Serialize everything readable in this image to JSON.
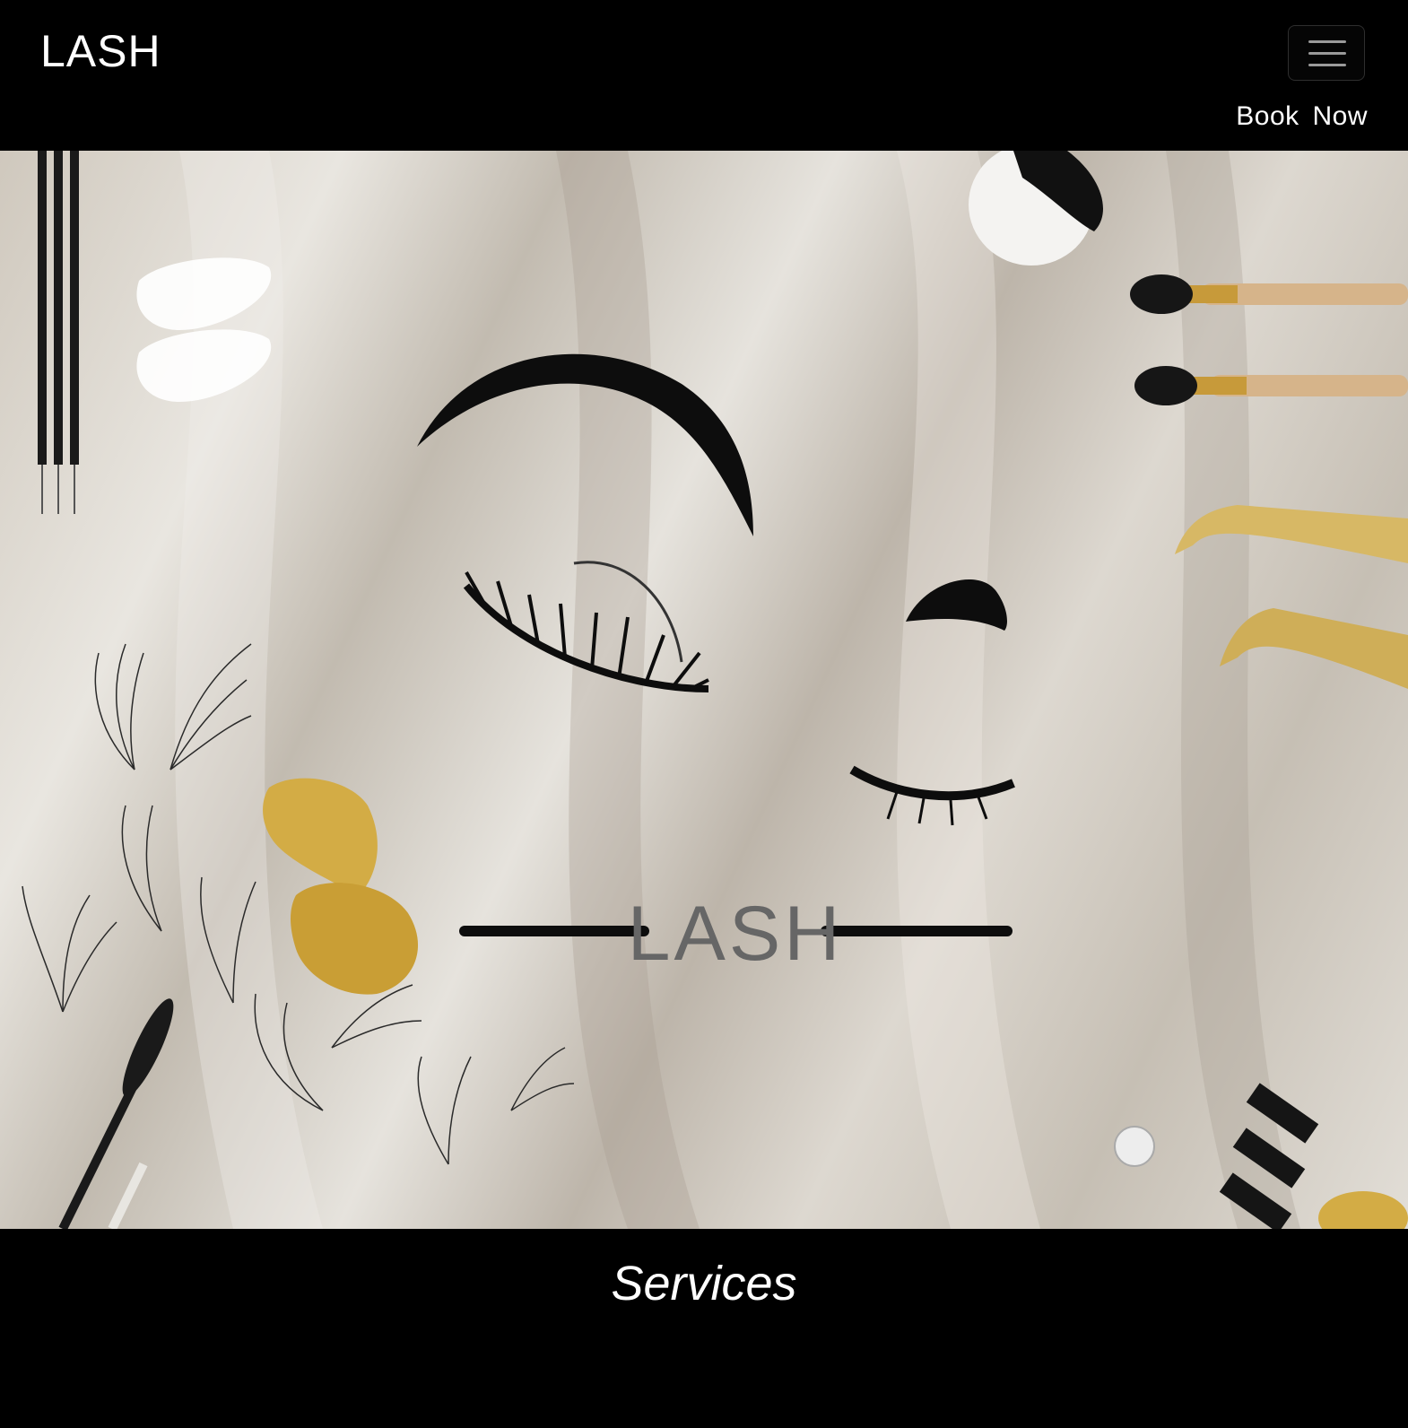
{
  "navbar": {
    "brand": "LASH",
    "menu_icon": "hamburger-menu-icon",
    "book_now_label": "Book Now"
  },
  "hero": {
    "logo_text": "LASH",
    "accent_gold": "#c9a23a",
    "accent_black": "#0d0d0d"
  },
  "services": {
    "title": "Services"
  }
}
